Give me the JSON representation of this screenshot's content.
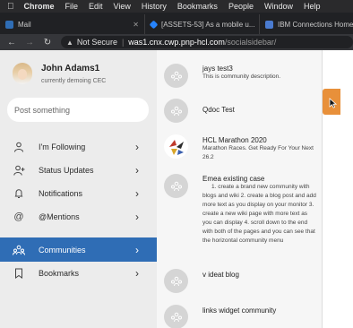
{
  "menubar": {
    "apple_icon": "apple-logo-icon",
    "items": [
      "Chrome",
      "File",
      "Edit",
      "View",
      "History",
      "Bookmarks",
      "People",
      "Window",
      "Help"
    ]
  },
  "tabs": [
    {
      "title": "Mail",
      "favicon_color": "#2f6db5"
    },
    {
      "title": "[ASSETS-53] As a mobile u...",
      "favicon_color": "#2684ff"
    },
    {
      "title": "IBM Connections Home Pa...",
      "favicon_color": "#4a7bd0"
    }
  ],
  "address_bar": {
    "security": "Not Secure",
    "host": "was1.cnx.cwp.pnp-hcl.com",
    "path": "/socialsidebar/"
  },
  "profile": {
    "name": "John Adams1",
    "status": "currently demoing CEC"
  },
  "post": {
    "placeholder": "Post something"
  },
  "nav": [
    {
      "label": "I'm Following",
      "icon": "person-icon"
    },
    {
      "label": "Status Updates",
      "icon": "person-add-icon"
    },
    {
      "label": "Notifications",
      "icon": "bell-icon"
    },
    {
      "label": "@Mentions",
      "icon": "at-icon"
    },
    {
      "label": "Communities",
      "icon": "communities-icon",
      "active": true
    },
    {
      "label": "Bookmarks",
      "icon": "bookmark-icon"
    }
  ],
  "communities": [
    {
      "title": "jays test3",
      "desc": "This is community description."
    },
    {
      "title": "Qdoc Test",
      "desc": ""
    },
    {
      "title": "HCL Marathon 2020",
      "desc": "Marathon Races. Get Ready For Your Next 26.2"
    },
    {
      "title": "Emea existing case",
      "desc": "1. create a brand new community with blogs and wiki 2. create a blog post and add more text as you display on your monitor 3. create a new wiki page with more text as you can display 4. scroll down to the end with both of the pages and you can see that the horizontal community menu"
    },
    {
      "title": "v ideat blog",
      "desc": ""
    },
    {
      "title": "links widget community",
      "desc": ""
    }
  ],
  "colors": {
    "active_nav": "#2f6db5",
    "handle": "#e8903a"
  }
}
